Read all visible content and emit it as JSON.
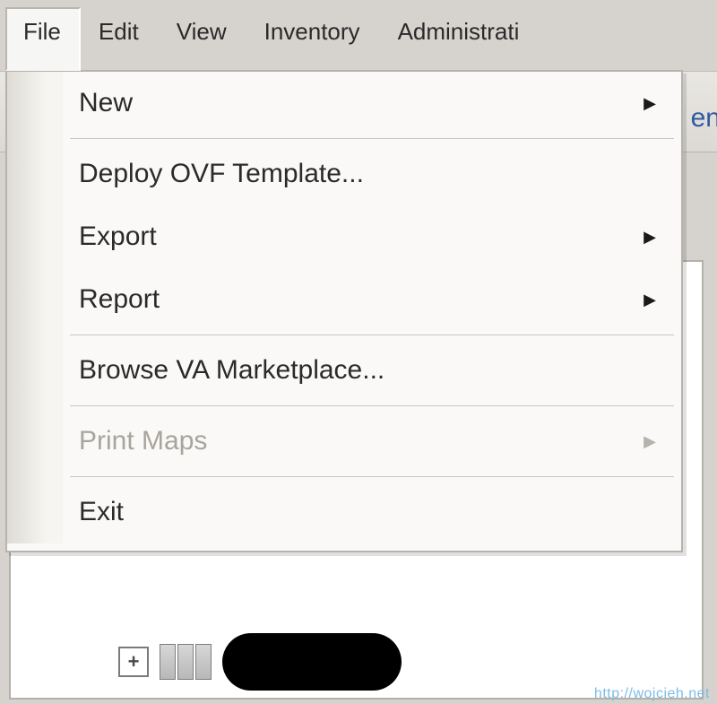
{
  "menubar": {
    "file": "File",
    "edit": "Edit",
    "view": "View",
    "inventory": "Inventory",
    "administration": "Administrati"
  },
  "file_menu": {
    "new": "New",
    "deploy_ovf": "Deploy OVF Template...",
    "export": "Export",
    "report": "Report",
    "browse_marketplace": "Browse VA Marketplace...",
    "print_maps": "Print Maps",
    "exit": "Exit"
  },
  "partial_text": "en",
  "watermark": "http://wojcieh.net"
}
